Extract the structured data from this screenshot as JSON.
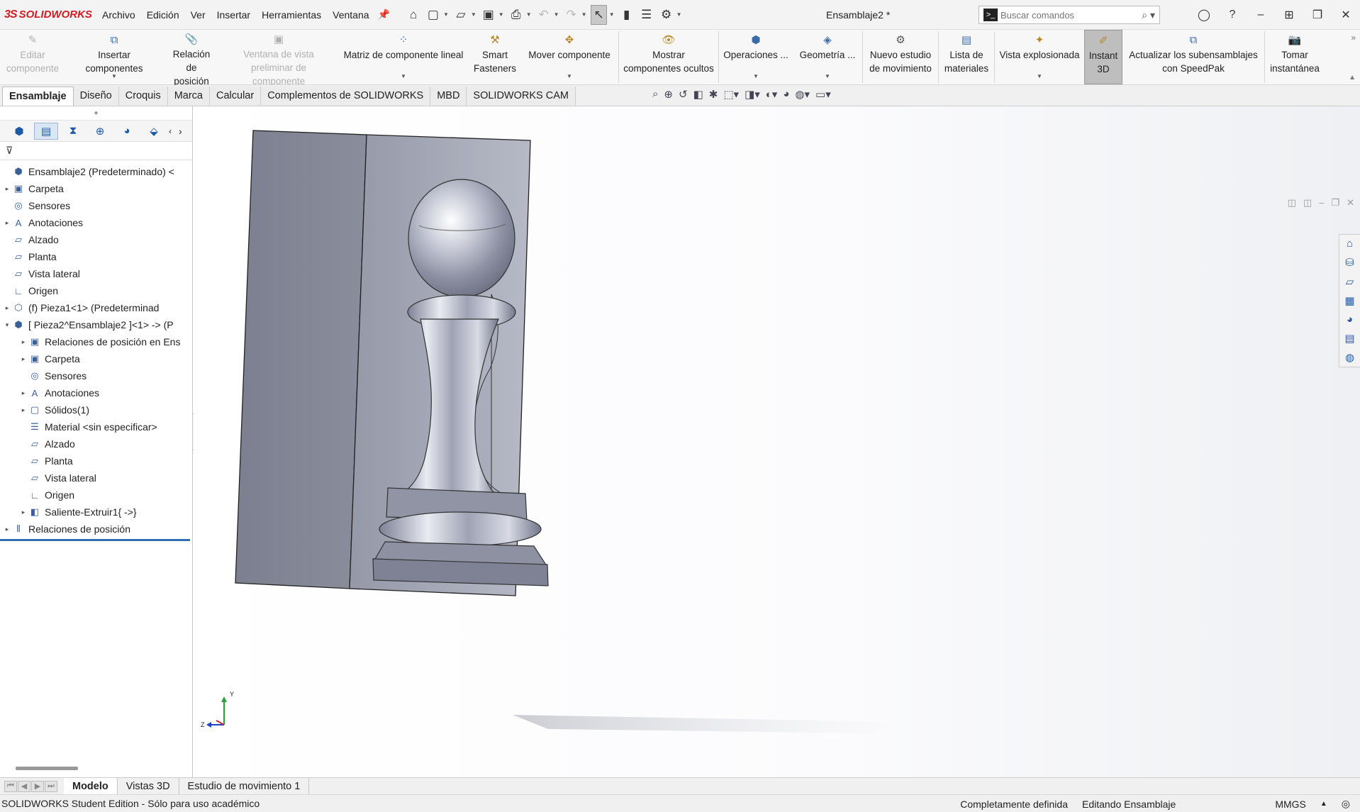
{
  "app": {
    "brand": "SOLIDWORKS",
    "brand_mark": "3S",
    "document_title": "Ensamblaje2 *"
  },
  "menu": [
    "Archivo",
    "Edición",
    "Ver",
    "Insertar",
    "Herramientas",
    "Ventana"
  ],
  "search": {
    "placeholder": "Buscar comandos"
  },
  "ribbon": [
    {
      "label": "Editar\ncomponente",
      "icon": "edit-component-icon",
      "disabled": true
    },
    {
      "label": "Insertar componentes",
      "icon": "insert-components-icon",
      "dropdown": true
    },
    {
      "label": "Relación de\nposición",
      "icon": "mate-icon"
    },
    {
      "label": "Ventana de vista\npreliminar de componente",
      "icon": "preview-window-icon",
      "disabled": true
    },
    {
      "label": "Matriz de componente lineal",
      "icon": "linear-pattern-icon",
      "dropdown": true
    },
    {
      "label": "Smart\nFasteners",
      "icon": "smart-fasteners-icon"
    },
    {
      "label": "Mover componente",
      "icon": "move-component-icon",
      "dropdown": true
    },
    {
      "label": "Mostrar\ncomponentes ocultos",
      "icon": "show-hidden-icon"
    },
    {
      "label": "Operaciones ...",
      "icon": "assembly-features-icon",
      "dropdown": true
    },
    {
      "label": "Geometría ...",
      "icon": "reference-geometry-icon",
      "dropdown": true
    },
    {
      "label": "Nuevo estudio\nde movimiento",
      "icon": "motion-study-icon"
    },
    {
      "label": "Lista de\nmateriales",
      "icon": "bom-icon"
    },
    {
      "label": "Vista explosionada",
      "icon": "exploded-view-icon",
      "dropdown": true
    },
    {
      "label": "Instant\n3D",
      "icon": "instant3d-icon",
      "active": true
    },
    {
      "label": "Actualizar los subensamblajes\ncon SpeedPak",
      "icon": "speedpak-icon"
    },
    {
      "label": "Tomar\ninstantánea",
      "icon": "snapshot-icon"
    }
  ],
  "command_tabs": [
    "Ensamblaje",
    "Diseño",
    "Croquis",
    "Marca",
    "Calcular",
    "Complementos de SOLIDWORKS",
    "MBD",
    "SOLIDWORKS CAM"
  ],
  "active_command_tab": "Ensamblaje",
  "tree": [
    {
      "label": "Ensamblaje2 (Predeterminado) <",
      "level": 0,
      "expand": "",
      "icon": "assembly-icon"
    },
    {
      "label": "Carpeta",
      "level": 1,
      "expand": "▸",
      "icon": "history-icon"
    },
    {
      "label": "Sensores",
      "level": 1,
      "expand": "",
      "icon": "sensor-icon"
    },
    {
      "label": "Anotaciones",
      "level": 1,
      "expand": "▸",
      "icon": "annotation-icon"
    },
    {
      "label": "Alzado",
      "level": 1,
      "expand": "",
      "icon": "plane-icon"
    },
    {
      "label": "Planta",
      "level": 1,
      "expand": "",
      "icon": "plane-icon"
    },
    {
      "label": "Vista lateral",
      "level": 1,
      "expand": "",
      "icon": "plane-icon"
    },
    {
      "label": "Origen",
      "level": 1,
      "expand": "",
      "icon": "origin-icon"
    },
    {
      "label": "(f) Pieza1<1> (Predeterminad",
      "level": 1,
      "expand": "▸",
      "icon": "part-icon"
    },
    {
      "label": "[ Pieza2^Ensamblaje2 ]<1> -> (P",
      "level": 1,
      "expand": "▾",
      "icon": "virtual-part-icon"
    },
    {
      "label": "Relaciones de posición en Ens",
      "level": 2,
      "expand": "▸",
      "icon": "mate-folder-icon"
    },
    {
      "label": "Carpeta",
      "level": 2,
      "expand": "▸",
      "icon": "history-icon"
    },
    {
      "label": "Sensores",
      "level": 2,
      "expand": "",
      "icon": "sensor-icon"
    },
    {
      "label": "Anotaciones",
      "level": 2,
      "expand": "▸",
      "icon": "annotation-icon"
    },
    {
      "label": "Sólidos(1)",
      "level": 2,
      "expand": "▸",
      "icon": "solid-bodies-icon"
    },
    {
      "label": "Material <sin especificar>",
      "level": 2,
      "expand": "",
      "icon": "material-icon"
    },
    {
      "label": "Alzado",
      "level": 2,
      "expand": "",
      "icon": "plane-icon"
    },
    {
      "label": "Planta",
      "level": 2,
      "expand": "",
      "icon": "plane-icon"
    },
    {
      "label": "Vista lateral",
      "level": 2,
      "expand": "",
      "icon": "plane-icon"
    },
    {
      "label": "Origen",
      "level": 2,
      "expand": "",
      "icon": "origin-icon"
    },
    {
      "label": "Saliente-Extruir1{ ->}",
      "level": 2,
      "expand": "▸",
      "icon": "extrude-icon"
    },
    {
      "label": "Relaciones de posición",
      "level": 0,
      "expand": "▸",
      "icon": "mates-icon"
    }
  ],
  "bottom_tabs": [
    "Modelo",
    "Vistas 3D",
    "Estudio de movimiento 1"
  ],
  "active_bottom_tab": "Modelo",
  "status": {
    "left": "SOLIDWORKS Student Edition - Sólo para uso académico",
    "definition": "Completamente definida",
    "mode": "Editando Ensamblaje",
    "units": "MMGS"
  },
  "triad": {
    "y": "Y",
    "z": "Z"
  },
  "colors": {
    "accent": "#2c6fb3",
    "brand": "#d11b22",
    "model": "#8a8e9c"
  }
}
